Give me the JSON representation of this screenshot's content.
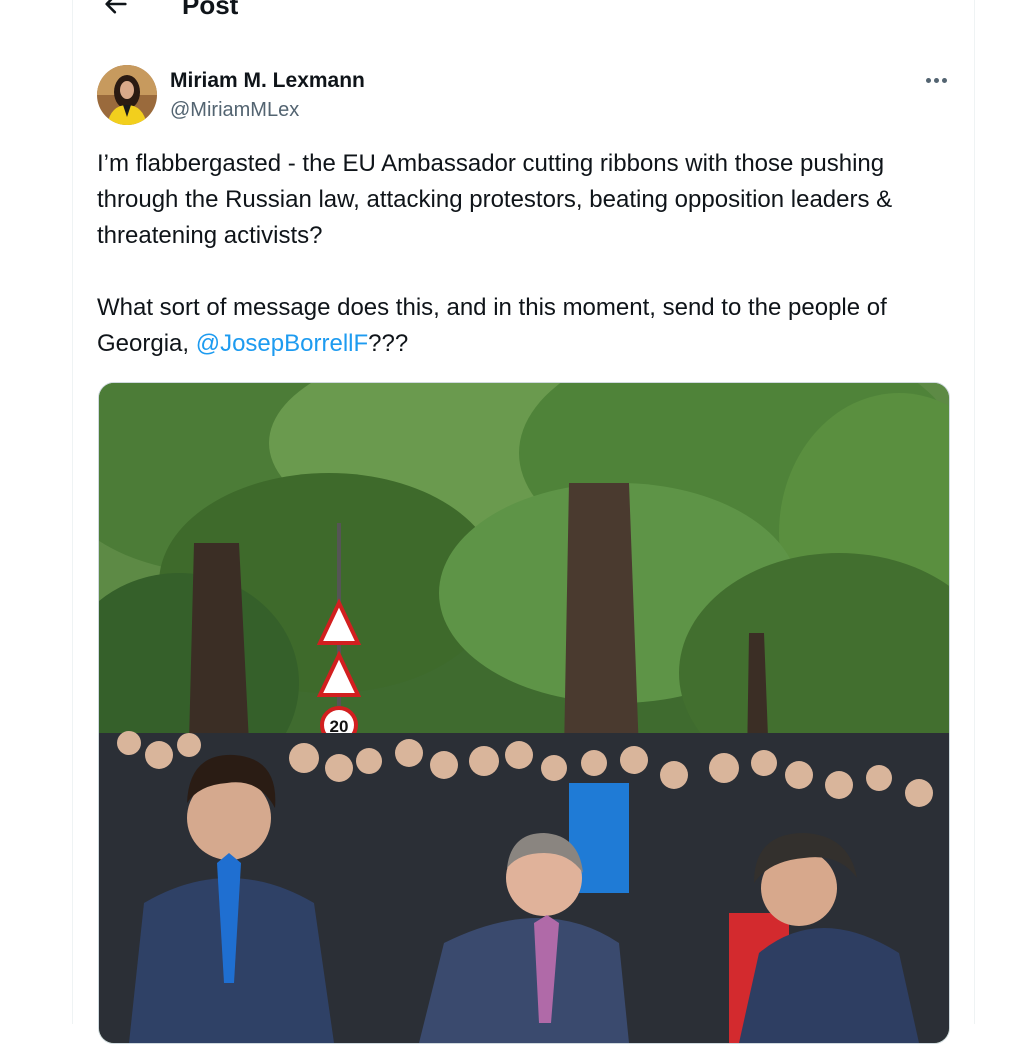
{
  "header": {
    "title": "Post",
    "back_icon": "arrow-left-icon"
  },
  "author": {
    "name": "Miriam M. Lexmann",
    "handle": "@MiriamMLex"
  },
  "tweet": {
    "paragraph1": "I’m flabbergasted - the EU Ambassador cutting ribbons with those pushing through the Russian law, attacking protestors, beating opposition leaders & threatening activists?",
    "paragraph2_before": "What sort of message does this, and in this moment, send to the people of Georgia, ",
    "mention": "@JosepBorrellF",
    "paragraph2_after": "???"
  },
  "photo": {
    "sign_speed_limit": "20"
  },
  "colors": {
    "link": "#1d9bf0",
    "secondary_text": "#536471",
    "border": "#cfd9de"
  }
}
